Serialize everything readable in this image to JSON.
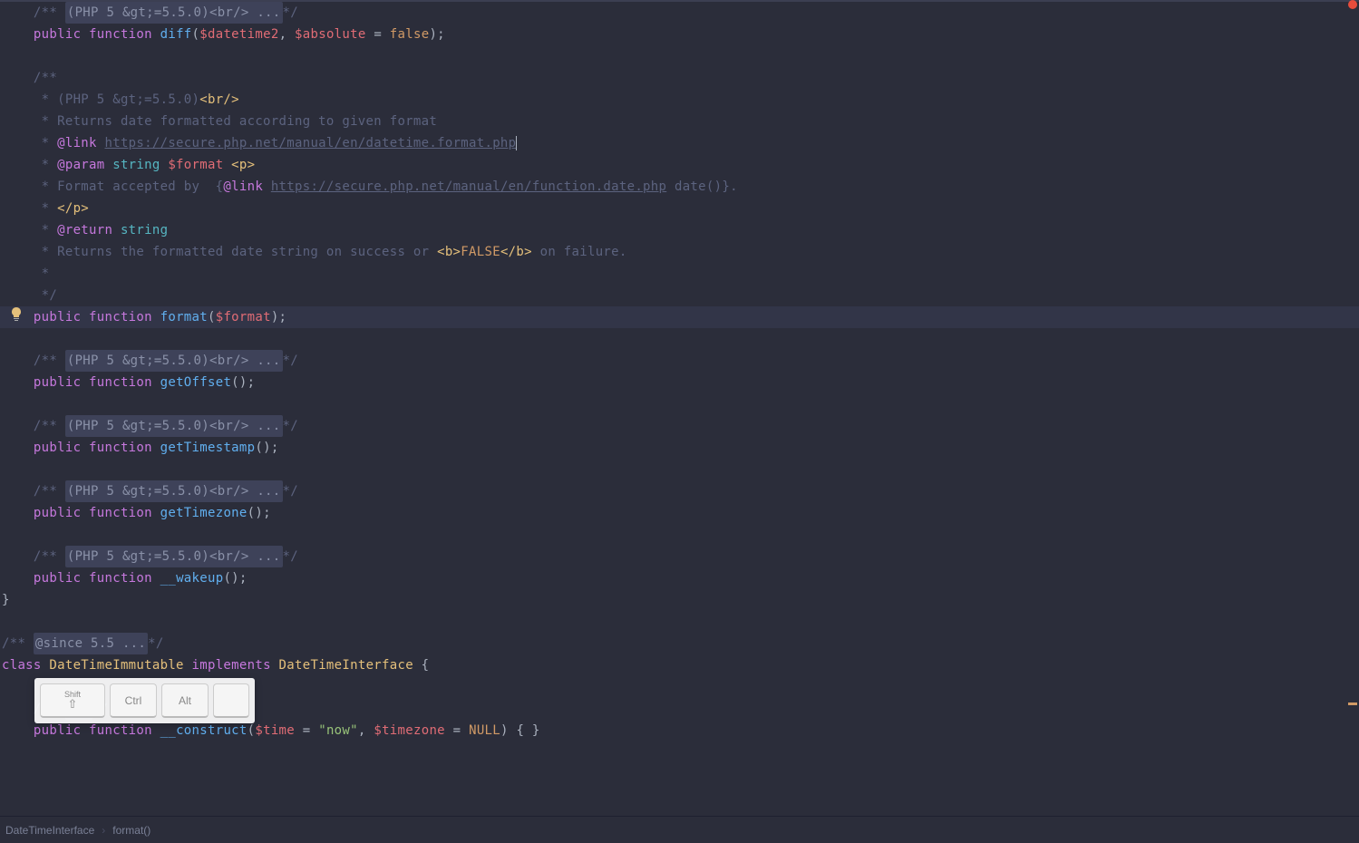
{
  "colors": {
    "background": "#2b2d3a",
    "comment": "#5c637f",
    "keyword": "#c678dd",
    "function": "#61afef",
    "variable": "#e06c75",
    "string": "#98c379",
    "constant": "#d19a66",
    "type": "#56b6c2",
    "punctuation": "#abb2bf",
    "tag": "#e5c07b",
    "classname": "#e5c07b",
    "highlight_line": "#323548"
  },
  "code": {
    "fold_text_php55": "(PHP 5 &gt;=5.5.0)<br/> ...",
    "fold_text_since55": "@since 5.5 ...",
    "comment_open": "/**",
    "comment_mid": " *",
    "comment_close": " */",
    "public": "public",
    "function": "function",
    "class": "class",
    "implements": "implements",
    "diff_fn": "diff",
    "diff_param1": "$datetime2",
    "diff_param2": "$absolute",
    "diff_default": "false",
    "docblock": {
      "line1_prefix": " * (PHP 5 ",
      "line1_entity": "&gt;",
      "line1_suffix": "=5.5.0)",
      "line1_tag": "<br/>",
      "line2": " * Returns date formatted according to given format",
      "line3_tag": "@link",
      "line3_url": "https://secure.php.net/manual/en/datetime.format.php",
      "line4_tag": "@param",
      "line4_type": "string",
      "line4_var": "$format",
      "line4_trail": "<p>",
      "line5_pre": " * Format accepted by  {",
      "line5_tag": "@link",
      "line5_url": "https://secure.php.net/manual/en/function.date.php",
      "line5_trail": " date()}.",
      "line6": " * </p>",
      "line7_tag": "@return",
      "line7_type": "string",
      "line8_pre": " * Returns the formatted date string on success or ",
      "line8_b_open": "<b>",
      "line8_false": "FALSE",
      "line8_b_close": "</b>",
      "line8_trail": " on failure."
    },
    "format_fn": "format",
    "format_param": "$format",
    "getOffset_fn": "getOffset",
    "getTimestamp_fn": "getTimestamp",
    "getTimezone_fn": "getTimezone",
    "wakeup_fn": "__wakeup",
    "class_name": "DateTimeImmutable",
    "interface_name": "DateTimeInterface",
    "construct_fn": "__construct",
    "construct_p1": "$time",
    "construct_p1_default": "\"now\"",
    "construct_p2": "$timezone",
    "construct_p2_default": "NULL",
    "close_brace": "}"
  },
  "keycaps": {
    "shift": "Shift",
    "ctrl": "Ctrl",
    "alt": "Alt"
  },
  "breadcrumb": {
    "item1": "DateTimeInterface",
    "item2": "format()"
  }
}
